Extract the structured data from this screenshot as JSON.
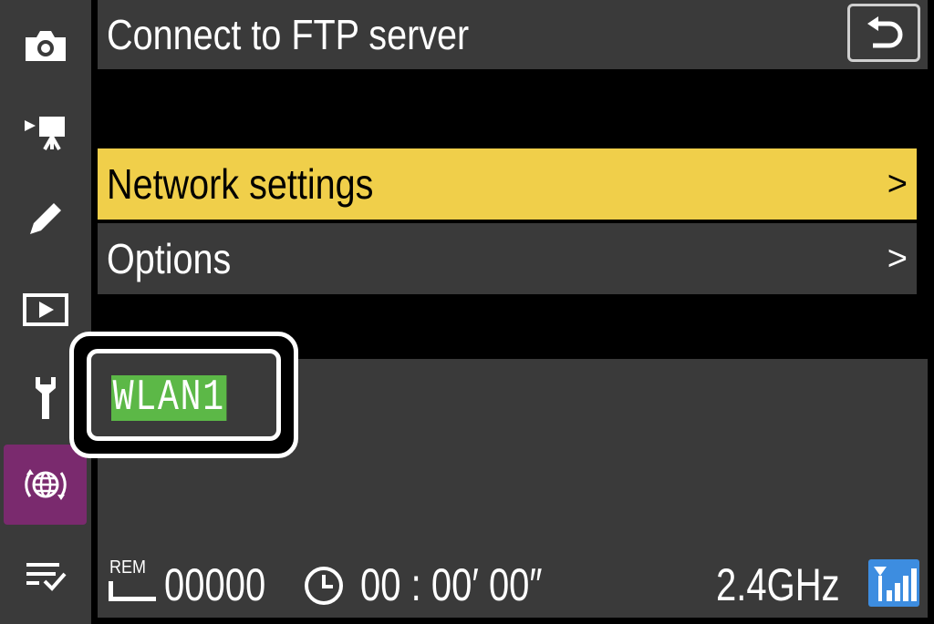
{
  "header": {
    "title": "Connect to FTP server",
    "back_icon": "back-return-icon"
  },
  "sidebar": {
    "items": [
      {
        "name": "photo-shooting-menu",
        "icon": "camera-icon"
      },
      {
        "name": "movie-recording-menu",
        "icon": "movie-camera-icon"
      },
      {
        "name": "custom-settings-menu",
        "icon": "pencil-icon"
      },
      {
        "name": "playback-menu",
        "icon": "play-icon"
      },
      {
        "name": "setup-menu",
        "icon": "wrench-icon"
      },
      {
        "name": "network-menu",
        "icon": "network-globe-icon",
        "active": true
      },
      {
        "name": "my-menu",
        "icon": "my-menu-list-icon"
      }
    ]
  },
  "menu": {
    "items": [
      {
        "label": "Network settings",
        "chevron": ">",
        "selected": true
      },
      {
        "label": "Options",
        "chevron": ">",
        "selected": false
      }
    ]
  },
  "status": {
    "network_name": "WLAN1",
    "rem_label": "REM",
    "remaining_count": "00000",
    "elapsed_time": "00 : 00′ 00″",
    "band": "2.4GHz",
    "signal_icon": "signal-strength-icon"
  },
  "colors": {
    "highlight": "#f0cf4a",
    "panel": "#3a3a3a",
    "active_tab": "#7a2a6e",
    "network_name_bg": "#5cb847",
    "signal_bg": "#3d8de0"
  }
}
